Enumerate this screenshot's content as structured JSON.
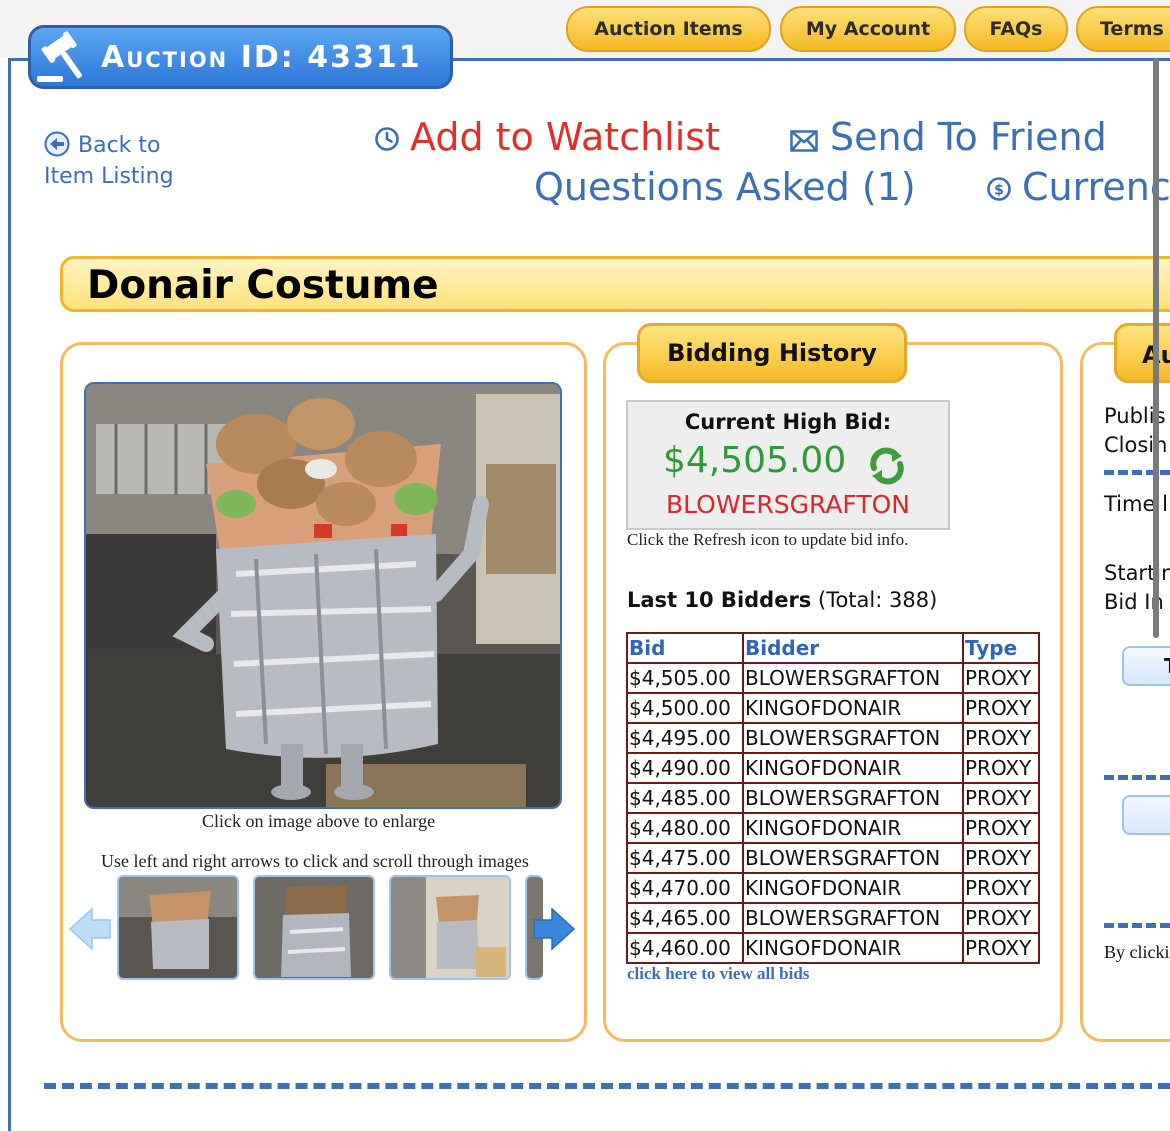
{
  "nav": {
    "tabs": [
      "Auction Items",
      "My Account",
      "FAQs",
      "Terms"
    ]
  },
  "auction": {
    "label": "Auction ID: 43311"
  },
  "back_link": {
    "line1": "Back to",
    "line2": "Item Listing"
  },
  "actions": {
    "watchlist": "Add to Watchlist",
    "send_friend": "Send To Friend",
    "questions": "Questions Asked (1)",
    "currency": "Currenc"
  },
  "item": {
    "title": "Donair Costume"
  },
  "gallery": {
    "enlarge_hint": "Click on image above to enlarge",
    "scroll_hint": "Use left and right arrows to click and scroll through images"
  },
  "bidding": {
    "tab_label": "Bidding History",
    "high_bid_label": "Current High Bid:",
    "high_bid_amount": "$4,505.00",
    "high_bidder": "BLOWERSGRAFTON",
    "refresh_hint": "Click the Refresh icon to update bid info.",
    "last_bidders_label": "Last 10 Bidders",
    "total_text": "(Total: 388)",
    "columns": [
      "Bid",
      "Bidder",
      "Type"
    ],
    "rows": [
      [
        "$4,505.00",
        "BLOWERSGRAFTON",
        "PROXY"
      ],
      [
        "$4,500.00",
        "KINGOFDONAIR",
        "PROXY"
      ],
      [
        "$4,495.00",
        "BLOWERSGRAFTON",
        "PROXY"
      ],
      [
        "$4,490.00",
        "KINGOFDONAIR",
        "PROXY"
      ],
      [
        "$4,485.00",
        "BLOWERSGRAFTON",
        "PROXY"
      ],
      [
        "$4,480.00",
        "KINGOFDONAIR",
        "PROXY"
      ],
      [
        "$4,475.00",
        "BLOWERSGRAFTON",
        "PROXY"
      ],
      [
        "$4,470.00",
        "KINGOFDONAIR",
        "PROXY"
      ],
      [
        "$4,465.00",
        "BLOWERSGRAFTON",
        "PROXY"
      ],
      [
        "$4,460.00",
        "KINGOFDONAIR",
        "PROXY"
      ]
    ],
    "view_all": "click here to view all bids"
  },
  "info_panel": {
    "tab_label": "Au",
    "published": "Publis",
    "closing": "Closin",
    "time_left": "Time l",
    "starting": "Startin",
    "bid_inc": "Bid In",
    "button1": "T",
    "disclaimer": "By clicki"
  },
  "colors": {
    "frame_blue": "#3f6fb5",
    "tab_gold": "#f6bb26",
    "link_red": "#e0302c",
    "link_blue": "#3d6fb6",
    "bid_green": "#2f9a3a"
  }
}
